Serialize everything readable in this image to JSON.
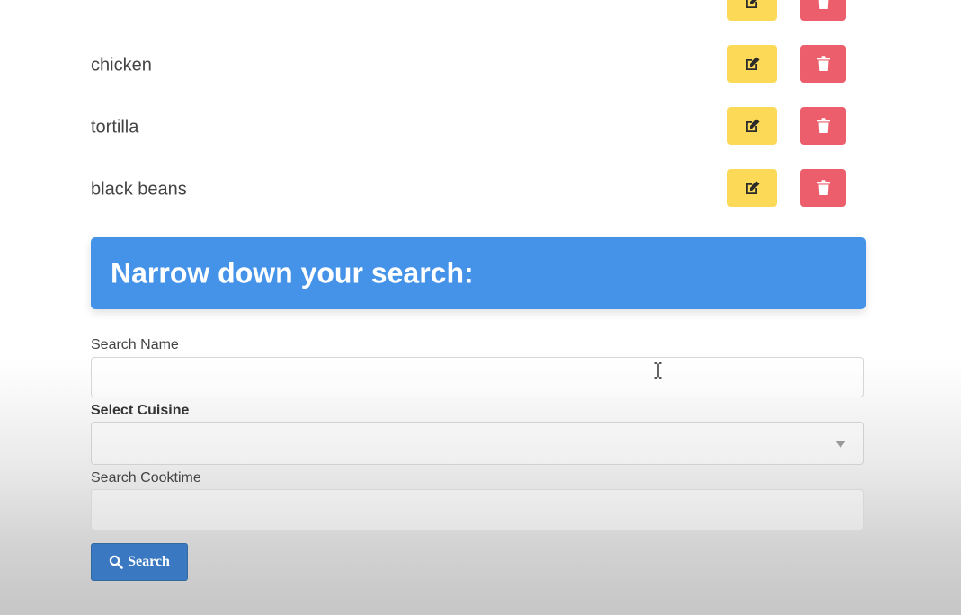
{
  "ingredients": [
    {
      "name": "",
      "edit_icon": "edit-icon",
      "delete_icon": "trash-icon"
    },
    {
      "name": "chicken",
      "edit_icon": "edit-icon",
      "delete_icon": "trash-icon"
    },
    {
      "name": "tortilla",
      "edit_icon": "edit-icon",
      "delete_icon": "trash-icon"
    },
    {
      "name": "black beans",
      "edit_icon": "edit-icon",
      "delete_icon": "trash-icon"
    }
  ],
  "search_panel": {
    "title": "Narrow down your search:",
    "name_label": "Search Name",
    "name_value": "",
    "cuisine_label": "Select Cuisine",
    "cuisine_value": "",
    "cooktime_label": "Search Cooktime",
    "cooktime_value": "",
    "search_button_label": "Search",
    "search_button_icon": "search-icon"
  },
  "colors": {
    "edit_button": "#fcd957",
    "delete_button": "#ec5e6b",
    "banner": "#4593e8",
    "search_button": "#3a79c2"
  }
}
